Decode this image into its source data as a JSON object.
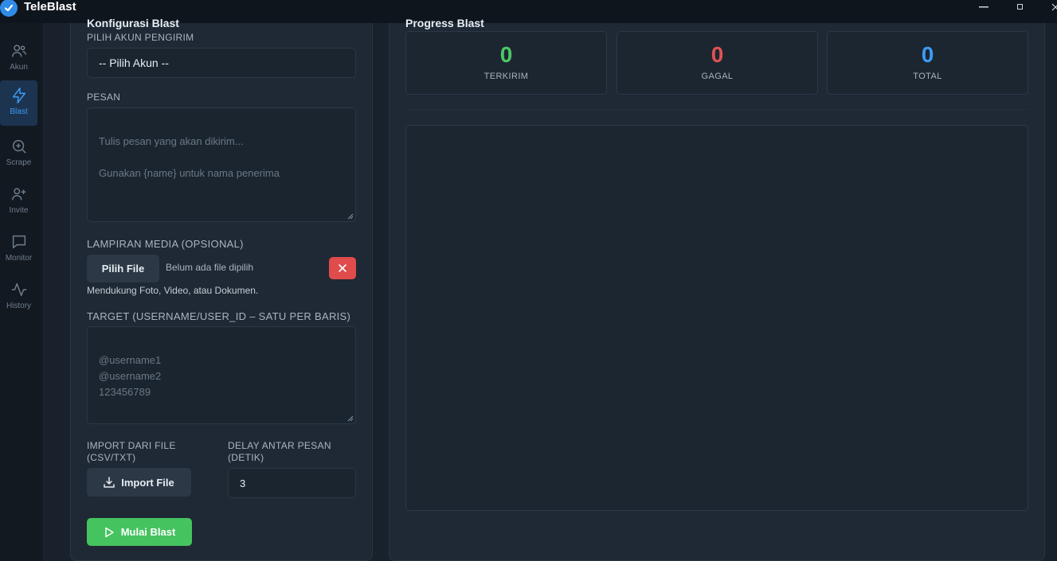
{
  "app": {
    "title": "TeleBlast"
  },
  "window_controls": {
    "minimize": "—",
    "maximize": "▫",
    "close": "✕"
  },
  "sidebar": {
    "items": [
      {
        "label": "Akun",
        "icon": "users-icon",
        "active": false
      },
      {
        "label": "Blast",
        "icon": "lightning-icon",
        "active": true
      },
      {
        "label": "Scrape",
        "icon": "search-zoom-icon",
        "active": false
      },
      {
        "label": "Invite",
        "icon": "user-plus-icon",
        "active": false
      },
      {
        "label": "Monitor",
        "icon": "chat-icon",
        "active": false
      },
      {
        "label": "History",
        "icon": "activity-icon",
        "active": false
      }
    ]
  },
  "config": {
    "title": "Konfigurasi Blast",
    "sender_label": "PILIH AKUN PENGIRIM",
    "sender_value": "-- Pilih Akun --",
    "message_label": "PESAN",
    "message_placeholder": "Tulis pesan yang akan dikirim...\n\nGunakan {name} untuk nama penerima",
    "media_label": "LAMPIRAN MEDIA (OPSIONAL)",
    "choose_file_label": "Pilih File",
    "file_status": "Belum ada file dipilih",
    "clear_icon": "close-icon",
    "media_hint": "Mendukung Foto, Video, atau Dokumen.",
    "target_label": "TARGET (USERNAME/USER_ID – SATU PER BARIS)",
    "target_placeholder": "@username1\n@username2\n123456789",
    "import_label": "IMPORT DARI FILE (CSV/TXT)",
    "import_button": "Import File",
    "delay_label": "DELAY ANTAR PESAN (DETIK)",
    "delay_value": "3",
    "start_button": "Mulai Blast"
  },
  "progress": {
    "title": "Progress Blast",
    "stats": [
      {
        "value": "0",
        "label": "TERKIRIM",
        "color": "#4cc764"
      },
      {
        "value": "0",
        "label": "GAGAL",
        "color": "#e05252"
      },
      {
        "value": "0",
        "label": "TOTAL",
        "color": "#3b9cf5"
      }
    ]
  }
}
